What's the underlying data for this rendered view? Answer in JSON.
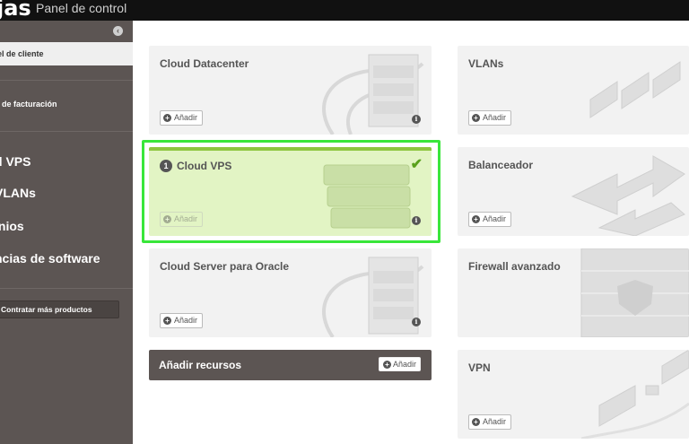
{
  "header": {
    "logo": "jas",
    "subtitle": "Panel de control"
  },
  "sidebar": {
    "client_panel": "el de cliente",
    "billing": "l de facturación",
    "nav": [
      "d VPS",
      "VLANs",
      "inios",
      "ncias de software"
    ],
    "more_button": "Contratar más productos"
  },
  "cards": {
    "add_label": "Añadir",
    "datacenter": {
      "title": "Cloud Datacenter"
    },
    "vlans": {
      "title": "VLANs"
    },
    "vps": {
      "number": "1",
      "title": "Cloud VPS"
    },
    "balancer": {
      "title": "Balanceador"
    },
    "oracle": {
      "title": "Cloud Server para Oracle"
    },
    "firewall": {
      "title": "Firewall avanzado"
    },
    "vpn": {
      "title": "VPN"
    }
  },
  "resources": {
    "label": "Añadir recursos",
    "button": "Añadir"
  },
  "colors": {
    "topbar": "#111111",
    "sidebar": "#5c5553",
    "selected": "#e2f4c4",
    "accent_green": "#8dc63f",
    "highlight": "#39e63a"
  }
}
